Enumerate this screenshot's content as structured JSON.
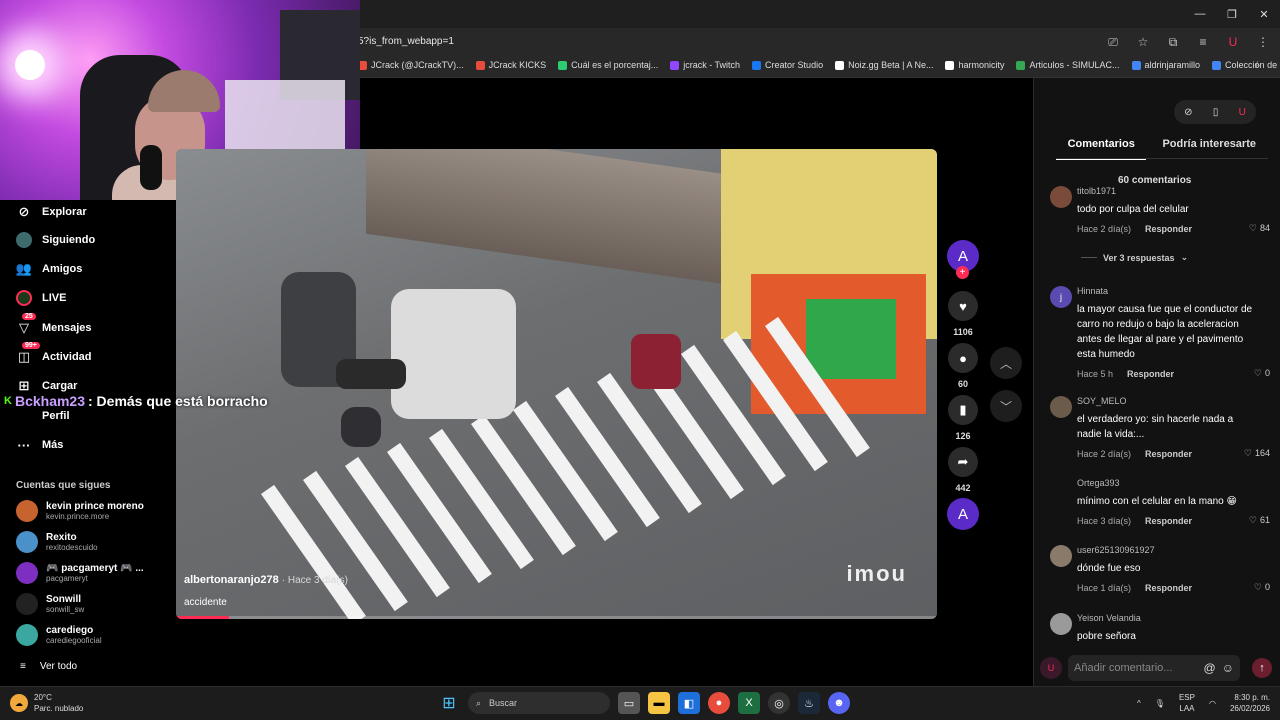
{
  "browser": {
    "url": "5?is_from_webapp=1",
    "bookmarks": [
      "JCrack (@JCrackTV)...",
      "JCrack KICKS",
      "Cuál es el porcentaj...",
      "jcrack - Twitch",
      "Creator Studio",
      "Noiz.gg Beta | A Ne...",
      "harmonicity",
      "Articulos - SIMULAC...",
      "aldrinjaramillo",
      "Colección de M_blei..."
    ],
    "more": "»"
  },
  "sidebar": {
    "items": [
      "Explorar",
      "Siguiendo",
      "Amigos",
      "LIVE",
      "Mensajes",
      "Actividad",
      "Cargar",
      "Perfil",
      "Más"
    ],
    "badges": {
      "mensajes": "25",
      "actividad": "99+"
    },
    "following_title": "Cuentas que sigues",
    "following": [
      {
        "name": "kevin prince moreno",
        "handle": "kevin.prince.more",
        "color": "#c7632e"
      },
      {
        "name": "Rexito",
        "handle": "rexitodescuido",
        "color": "#4a90c9"
      },
      {
        "name": "🎮 pacgameryt 🎮 ...",
        "handle": "pacgameryt",
        "color": "#7c2fc0"
      },
      {
        "name": "Sonwill",
        "handle": "sonwill_sw",
        "color": "#222222"
      },
      {
        "name": "carediego",
        "handle": "carediegooficial",
        "color": "#3aa7a0"
      }
    ],
    "see_all": "Ver todo"
  },
  "chat": {
    "user": "Bckham23",
    "message": ": Demás que está borracho"
  },
  "video": {
    "author": "albertonaranjo278",
    "time": "· Hace 3 día(s)",
    "description": "accidente",
    "watermark": "imou",
    "progress": 0.07
  },
  "actions": {
    "likes": "1106",
    "comments": "60",
    "saves": "126",
    "shares": "442",
    "avatar_letter": "A"
  },
  "panel": {
    "tab_comments": "Comentarios",
    "tab_other": "Podría interesarte",
    "count": "60 comentarios",
    "view_replies": "Ver 3 respuestas",
    "comments": [
      {
        "user": "titolb1971",
        "text": "todo por culpa del celular",
        "time": "Hace 2 día(s)",
        "reply": "Responder",
        "likes": "84",
        "avatar": "",
        "color": "#7a4a3a"
      },
      {
        "user": "Hinnata",
        "text": "la mayor causa fue que el conductor de carro no redujo o bajo la aceleracion antes de llegar al pare y el pavimento esta humedo",
        "time": "Hace 5 h",
        "reply": "Responder",
        "likes": "0",
        "avatar": "j",
        "color": "#5a4bb0"
      },
      {
        "user": "SOY_MELO",
        "text": "el verdadero yo: sin hacerle nada a nadie la vida:...",
        "time": "Hace 2 día(s)",
        "reply": "Responder",
        "likes": "164",
        "avatar": "",
        "color": "#6b5b4a"
      },
      {
        "user": "Ortega393",
        "text": "mínimo con el celular en la mano 😁",
        "time": "Hace 3 día(s)",
        "reply": "Responder",
        "likes": "61",
        "avatar": "",
        "color": "#121212"
      },
      {
        "user": "user625130961927",
        "text": "dónde fue eso",
        "time": "Hace 1 día(s)",
        "reply": "Responder",
        "likes": "0",
        "avatar": "",
        "color": "#8a7a6a"
      },
      {
        "user": "Yeison Velandia",
        "text": "pobre señora",
        "time": "",
        "reply": "",
        "likes": "",
        "avatar": "",
        "color": "#9a9a9a"
      }
    ],
    "add_placeholder": "Añadir comentario..."
  },
  "taskbar": {
    "temp": "20°C",
    "weather": "Parc. nublado",
    "search": "Buscar",
    "lang1": "ESP",
    "lang2": "LAA",
    "time": "8:30 p. m.",
    "date": "26/02/2026"
  }
}
